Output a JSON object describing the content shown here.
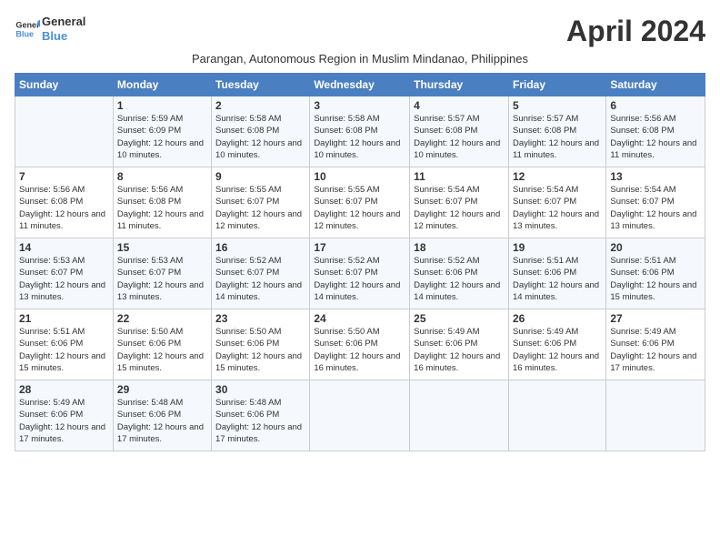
{
  "logo": {
    "line1": "General",
    "line2": "Blue"
  },
  "title": "April 2024",
  "subtitle": "Parangan, Autonomous Region in Muslim Mindanao, Philippines",
  "header_days": [
    "Sunday",
    "Monday",
    "Tuesday",
    "Wednesday",
    "Thursday",
    "Friday",
    "Saturday"
  ],
  "weeks": [
    [
      {
        "num": "",
        "sunrise": "",
        "sunset": "",
        "daylight": ""
      },
      {
        "num": "1",
        "sunrise": "Sunrise: 5:59 AM",
        "sunset": "Sunset: 6:09 PM",
        "daylight": "Daylight: 12 hours and 10 minutes."
      },
      {
        "num": "2",
        "sunrise": "Sunrise: 5:58 AM",
        "sunset": "Sunset: 6:08 PM",
        "daylight": "Daylight: 12 hours and 10 minutes."
      },
      {
        "num": "3",
        "sunrise": "Sunrise: 5:58 AM",
        "sunset": "Sunset: 6:08 PM",
        "daylight": "Daylight: 12 hours and 10 minutes."
      },
      {
        "num": "4",
        "sunrise": "Sunrise: 5:57 AM",
        "sunset": "Sunset: 6:08 PM",
        "daylight": "Daylight: 12 hours and 10 minutes."
      },
      {
        "num": "5",
        "sunrise": "Sunrise: 5:57 AM",
        "sunset": "Sunset: 6:08 PM",
        "daylight": "Daylight: 12 hours and 11 minutes."
      },
      {
        "num": "6",
        "sunrise": "Sunrise: 5:56 AM",
        "sunset": "Sunset: 6:08 PM",
        "daylight": "Daylight: 12 hours and 11 minutes."
      }
    ],
    [
      {
        "num": "7",
        "sunrise": "Sunrise: 5:56 AM",
        "sunset": "Sunset: 6:08 PM",
        "daylight": "Daylight: 12 hours and 11 minutes."
      },
      {
        "num": "8",
        "sunrise": "Sunrise: 5:56 AM",
        "sunset": "Sunset: 6:08 PM",
        "daylight": "Daylight: 12 hours and 11 minutes."
      },
      {
        "num": "9",
        "sunrise": "Sunrise: 5:55 AM",
        "sunset": "Sunset: 6:07 PM",
        "daylight": "Daylight: 12 hours and 12 minutes."
      },
      {
        "num": "10",
        "sunrise": "Sunrise: 5:55 AM",
        "sunset": "Sunset: 6:07 PM",
        "daylight": "Daylight: 12 hours and 12 minutes."
      },
      {
        "num": "11",
        "sunrise": "Sunrise: 5:54 AM",
        "sunset": "Sunset: 6:07 PM",
        "daylight": "Daylight: 12 hours and 12 minutes."
      },
      {
        "num": "12",
        "sunrise": "Sunrise: 5:54 AM",
        "sunset": "Sunset: 6:07 PM",
        "daylight": "Daylight: 12 hours and 13 minutes."
      },
      {
        "num": "13",
        "sunrise": "Sunrise: 5:54 AM",
        "sunset": "Sunset: 6:07 PM",
        "daylight": "Daylight: 12 hours and 13 minutes."
      }
    ],
    [
      {
        "num": "14",
        "sunrise": "Sunrise: 5:53 AM",
        "sunset": "Sunset: 6:07 PM",
        "daylight": "Daylight: 12 hours and 13 minutes."
      },
      {
        "num": "15",
        "sunrise": "Sunrise: 5:53 AM",
        "sunset": "Sunset: 6:07 PM",
        "daylight": "Daylight: 12 hours and 13 minutes."
      },
      {
        "num": "16",
        "sunrise": "Sunrise: 5:52 AM",
        "sunset": "Sunset: 6:07 PM",
        "daylight": "Daylight: 12 hours and 14 minutes."
      },
      {
        "num": "17",
        "sunrise": "Sunrise: 5:52 AM",
        "sunset": "Sunset: 6:07 PM",
        "daylight": "Daylight: 12 hours and 14 minutes."
      },
      {
        "num": "18",
        "sunrise": "Sunrise: 5:52 AM",
        "sunset": "Sunset: 6:06 PM",
        "daylight": "Daylight: 12 hours and 14 minutes."
      },
      {
        "num": "19",
        "sunrise": "Sunrise: 5:51 AM",
        "sunset": "Sunset: 6:06 PM",
        "daylight": "Daylight: 12 hours and 14 minutes."
      },
      {
        "num": "20",
        "sunrise": "Sunrise: 5:51 AM",
        "sunset": "Sunset: 6:06 PM",
        "daylight": "Daylight: 12 hours and 15 minutes."
      }
    ],
    [
      {
        "num": "21",
        "sunrise": "Sunrise: 5:51 AM",
        "sunset": "Sunset: 6:06 PM",
        "daylight": "Daylight: 12 hours and 15 minutes."
      },
      {
        "num": "22",
        "sunrise": "Sunrise: 5:50 AM",
        "sunset": "Sunset: 6:06 PM",
        "daylight": "Daylight: 12 hours and 15 minutes."
      },
      {
        "num": "23",
        "sunrise": "Sunrise: 5:50 AM",
        "sunset": "Sunset: 6:06 PM",
        "daylight": "Daylight: 12 hours and 15 minutes."
      },
      {
        "num": "24",
        "sunrise": "Sunrise: 5:50 AM",
        "sunset": "Sunset: 6:06 PM",
        "daylight": "Daylight: 12 hours and 16 minutes."
      },
      {
        "num": "25",
        "sunrise": "Sunrise: 5:49 AM",
        "sunset": "Sunset: 6:06 PM",
        "daylight": "Daylight: 12 hours and 16 minutes."
      },
      {
        "num": "26",
        "sunrise": "Sunrise: 5:49 AM",
        "sunset": "Sunset: 6:06 PM",
        "daylight": "Daylight: 12 hours and 16 minutes."
      },
      {
        "num": "27",
        "sunrise": "Sunrise: 5:49 AM",
        "sunset": "Sunset: 6:06 PM",
        "daylight": "Daylight: 12 hours and 17 minutes."
      }
    ],
    [
      {
        "num": "28",
        "sunrise": "Sunrise: 5:49 AM",
        "sunset": "Sunset: 6:06 PM",
        "daylight": "Daylight: 12 hours and 17 minutes."
      },
      {
        "num": "29",
        "sunrise": "Sunrise: 5:48 AM",
        "sunset": "Sunset: 6:06 PM",
        "daylight": "Daylight: 12 hours and 17 minutes."
      },
      {
        "num": "30",
        "sunrise": "Sunrise: 5:48 AM",
        "sunset": "Sunset: 6:06 PM",
        "daylight": "Daylight: 12 hours and 17 minutes."
      },
      {
        "num": "",
        "sunrise": "",
        "sunset": "",
        "daylight": ""
      },
      {
        "num": "",
        "sunrise": "",
        "sunset": "",
        "daylight": ""
      },
      {
        "num": "",
        "sunrise": "",
        "sunset": "",
        "daylight": ""
      },
      {
        "num": "",
        "sunrise": "",
        "sunset": "",
        "daylight": ""
      }
    ]
  ]
}
